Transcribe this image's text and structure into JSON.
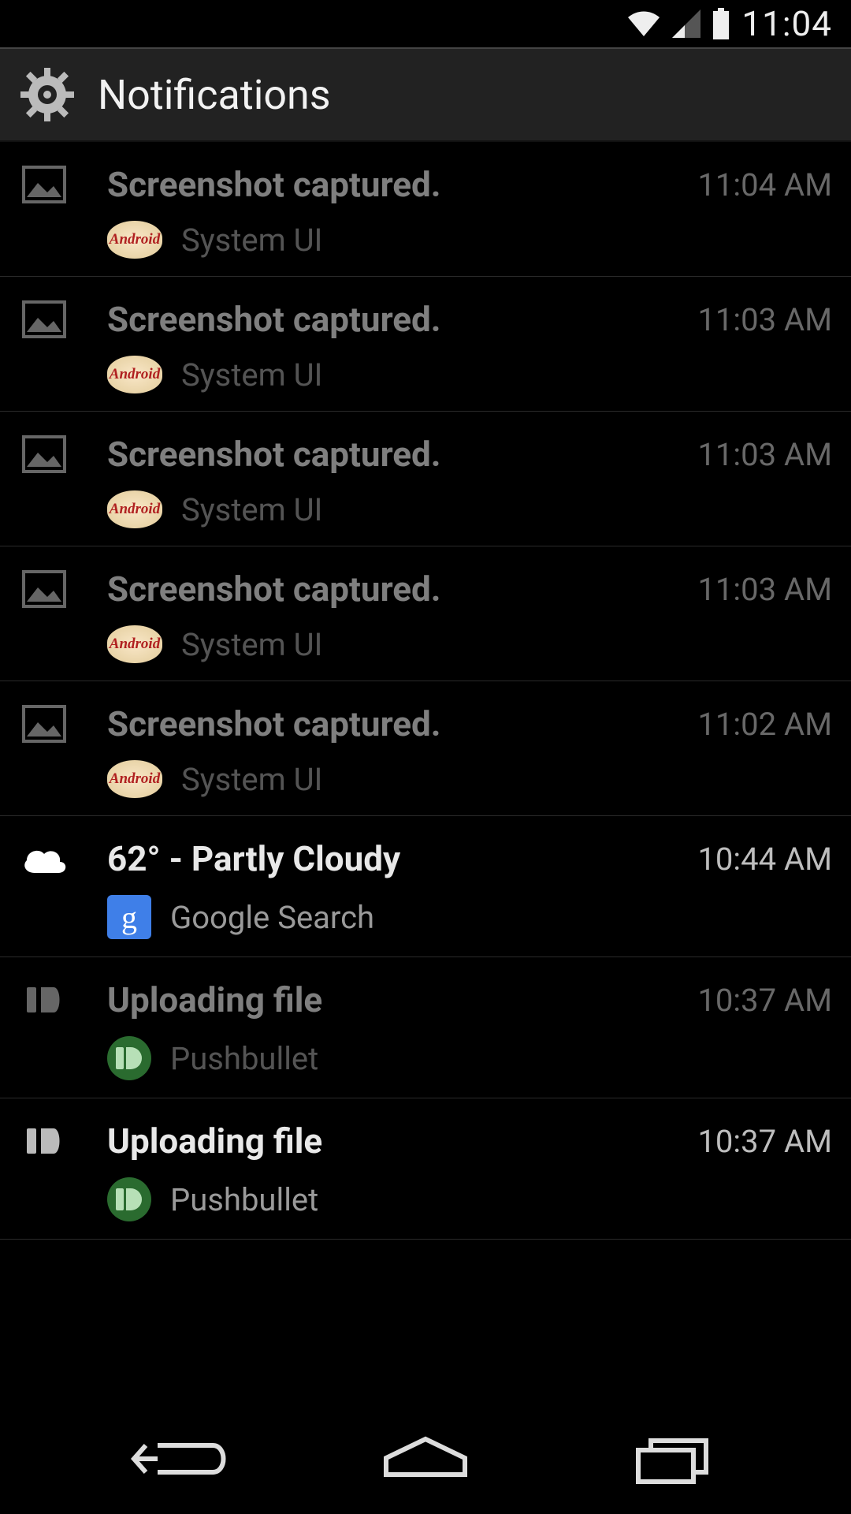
{
  "status": {
    "time": "11:04"
  },
  "header": {
    "title": "Notifications"
  },
  "icons": {
    "picture": "picture-icon",
    "cloud": "cloud-icon",
    "pushbullet": "pushbullet-icon"
  },
  "apps": {
    "system_ui": "System UI",
    "google_search": "Google Search",
    "pushbullet": "Pushbullet"
  },
  "notifications": [
    {
      "title": "Screenshot captured.",
      "time": "11:04 AM",
      "source": "System UI",
      "icon": "picture",
      "badge": "android",
      "dim": true
    },
    {
      "title": "Screenshot captured.",
      "time": "11:03 AM",
      "source": "System UI",
      "icon": "picture",
      "badge": "android",
      "dim": true
    },
    {
      "title": "Screenshot captured.",
      "time": "11:03 AM",
      "source": "System UI",
      "icon": "picture",
      "badge": "android",
      "dim": true
    },
    {
      "title": "Screenshot captured.",
      "time": "11:03 AM",
      "source": "System UI",
      "icon": "picture",
      "badge": "android",
      "dim": true
    },
    {
      "title": "Screenshot captured.",
      "time": "11:02 AM",
      "source": "System UI",
      "icon": "picture",
      "badge": "android",
      "dim": true
    },
    {
      "title": "62° - Partly Cloudy",
      "time": "10:44 AM",
      "source": "Google Search",
      "icon": "cloud",
      "badge": "google",
      "dim": false
    },
    {
      "title": "Uploading file",
      "time": "10:37 AM",
      "source": "Pushbullet",
      "icon": "pushbullet",
      "badge": "pushbullet",
      "dim": true
    },
    {
      "title": "Uploading file",
      "time": "10:37 AM",
      "source": "Pushbullet",
      "icon": "pushbullet",
      "badge": "pushbullet",
      "dim": false
    }
  ],
  "badge_text": {
    "google": "g"
  }
}
